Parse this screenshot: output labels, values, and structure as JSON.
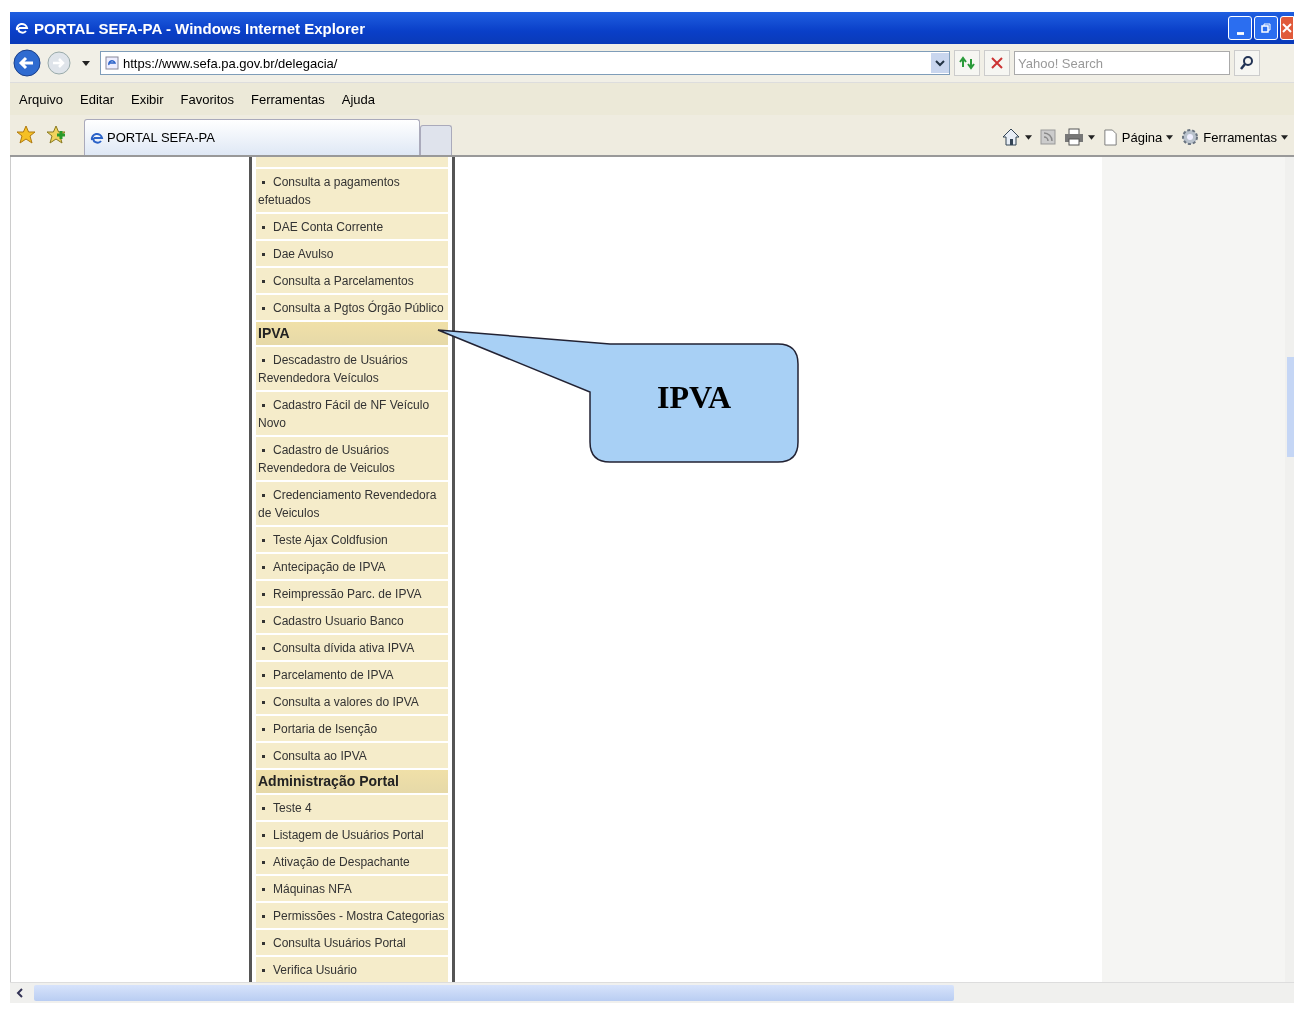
{
  "window": {
    "title": "PORTAL SEFA-PA - Windows Internet Explorer"
  },
  "address_bar": {
    "url": "https://www.sefa.pa.gov.br/delegacia/"
  },
  "search": {
    "placeholder": "Yahoo! Search"
  },
  "menu_bar": [
    "Arquivo",
    "Editar",
    "Exibir",
    "Favoritos",
    "Ferramentas",
    "Ajuda"
  ],
  "tabs": [
    {
      "label": "PORTAL SEFA-PA",
      "selected": true
    }
  ],
  "command_bar": [
    {
      "kind": "home"
    },
    {
      "kind": "feeds"
    },
    {
      "kind": "print"
    },
    {
      "kind": "page",
      "label": "Página"
    },
    {
      "kind": "tools",
      "label": "Ferramentas"
    }
  ],
  "sidebar": {
    "items": [
      {
        "kind": "link",
        "label": "Consulta a pagamentos efetuados"
      },
      {
        "kind": "link",
        "label": "DAE Conta Corrente"
      },
      {
        "kind": "link",
        "label": "Dae Avulso"
      },
      {
        "kind": "link",
        "label": "Consulta a Parcelamentos"
      },
      {
        "kind": "link",
        "label": "Consulta a Pgtos Órgão Público"
      },
      {
        "kind": "heading",
        "label": "IPVA"
      },
      {
        "kind": "link",
        "label": "Descadastro de Usuários Revendedora Veículos"
      },
      {
        "kind": "link",
        "label": "Cadastro Fácil de NF Veículo Novo"
      },
      {
        "kind": "link",
        "label": "Cadastro de Usuários Revendedora de Veiculos"
      },
      {
        "kind": "link",
        "label": "Credenciamento Revendedora de Veiculos"
      },
      {
        "kind": "link",
        "label": "Teste Ajax Coldfusion"
      },
      {
        "kind": "link",
        "label": "Antecipação de IPVA"
      },
      {
        "kind": "link",
        "label": "Reimpressão Parc. de IPVA"
      },
      {
        "kind": "link",
        "label": "Cadastro Usuario Banco"
      },
      {
        "kind": "link",
        "label": "Consulta dívida ativa IPVA"
      },
      {
        "kind": "link",
        "label": "Parcelamento de IPVA"
      },
      {
        "kind": "link",
        "label": "Consulta a valores do IPVA"
      },
      {
        "kind": "link",
        "label": "Portaria de Isenção"
      },
      {
        "kind": "link",
        "label": "Consulta ao IPVA"
      },
      {
        "kind": "heading",
        "label": "Administração Portal"
      },
      {
        "kind": "link",
        "label": "Teste 4"
      },
      {
        "kind": "link",
        "label": "Listagem de Usuários Portal"
      },
      {
        "kind": "link",
        "label": "Ativação de Despachante"
      },
      {
        "kind": "link",
        "label": "Máquinas NFA"
      },
      {
        "kind": "link",
        "label": "Permissões - Mostra Categorias"
      },
      {
        "kind": "link",
        "label": "Consulta Usuários Portal"
      },
      {
        "kind": "link",
        "label": "Verifica Usuário"
      }
    ]
  },
  "callout": {
    "text": "IPVA"
  }
}
